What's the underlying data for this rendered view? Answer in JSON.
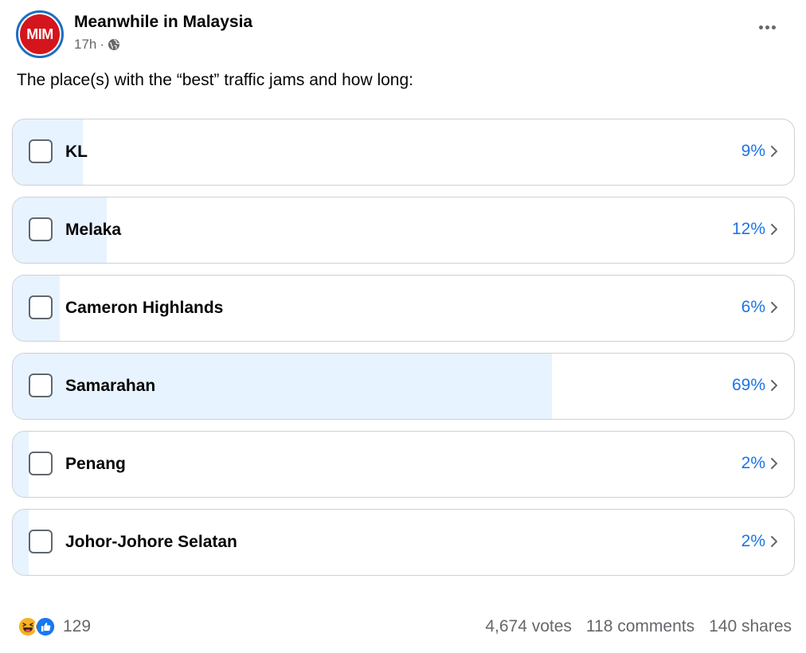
{
  "post": {
    "avatar_text": "MIM",
    "page_name": "Meanwhile in Malaysia",
    "time": "17h",
    "separator": "·",
    "question": "The place(s) with the “best” traffic jams and how long:"
  },
  "poll": {
    "options": [
      {
        "label": "KL",
        "percent_text": "9%",
        "percent": 9
      },
      {
        "label": "Melaka",
        "percent_text": "12%",
        "percent": 12
      },
      {
        "label": "Cameron Highlands",
        "percent_text": "6%",
        "percent": 6
      },
      {
        "label": "Samarahan",
        "percent_text": "69%",
        "percent": 69
      },
      {
        "label": "Penang",
        "percent_text": "2%",
        "percent": 2
      },
      {
        "label": "Johor-Johore Selatan",
        "percent_text": "2%",
        "percent": 2
      }
    ]
  },
  "footer": {
    "reaction_count": "129",
    "votes": "4,674 votes",
    "comments": "118 comments",
    "shares": "140 shares"
  },
  "icons": {
    "globe": "globe-icon",
    "more": "more-options-icon",
    "chevron": "chevron-right-icon",
    "haha": "haha-reaction-icon",
    "like": "like-reaction-icon"
  },
  "colors": {
    "accent": "#1b74e4",
    "fill": "#e7f3ff",
    "brand_red": "#d4151c",
    "border": "#ced0d4"
  }
}
